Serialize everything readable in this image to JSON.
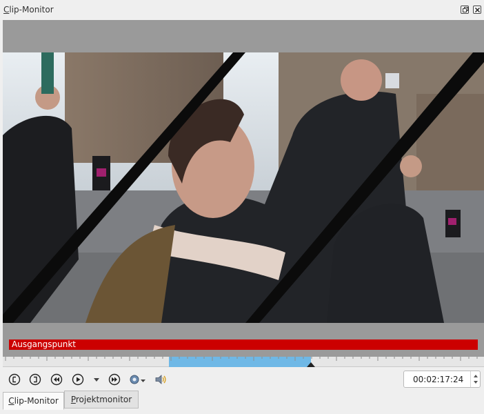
{
  "window": {
    "title": "Clip-Monitor",
    "title_mnemonic": "C",
    "title_rest": "lip-Monitor"
  },
  "overlay": {
    "label": "Ausgangspunkt",
    "color": "#cc0000"
  },
  "ruler": {
    "zone_color": "#6fb8e6",
    "zone_start_fraction": 0.345,
    "zone_end_fraction": 0.64,
    "playhead_fraction": 0.64
  },
  "controls": {
    "icons": [
      "set-zone-in-icon",
      "set-zone-out-icon",
      "rewind-icon",
      "play-icon",
      "play-options-dropdown-icon",
      "forward-icon",
      "view-options-icon",
      "audio-volume-icon"
    ],
    "timecode": "00:02:17:24"
  },
  "tabs": [
    {
      "label": "Clip-Monitor",
      "mnemonic": "C",
      "rest": "lip-Monitor",
      "active": true
    },
    {
      "label": "Projektmonitor",
      "mnemonic": "P",
      "rest": "rojektmonitor",
      "active": false
    }
  ]
}
